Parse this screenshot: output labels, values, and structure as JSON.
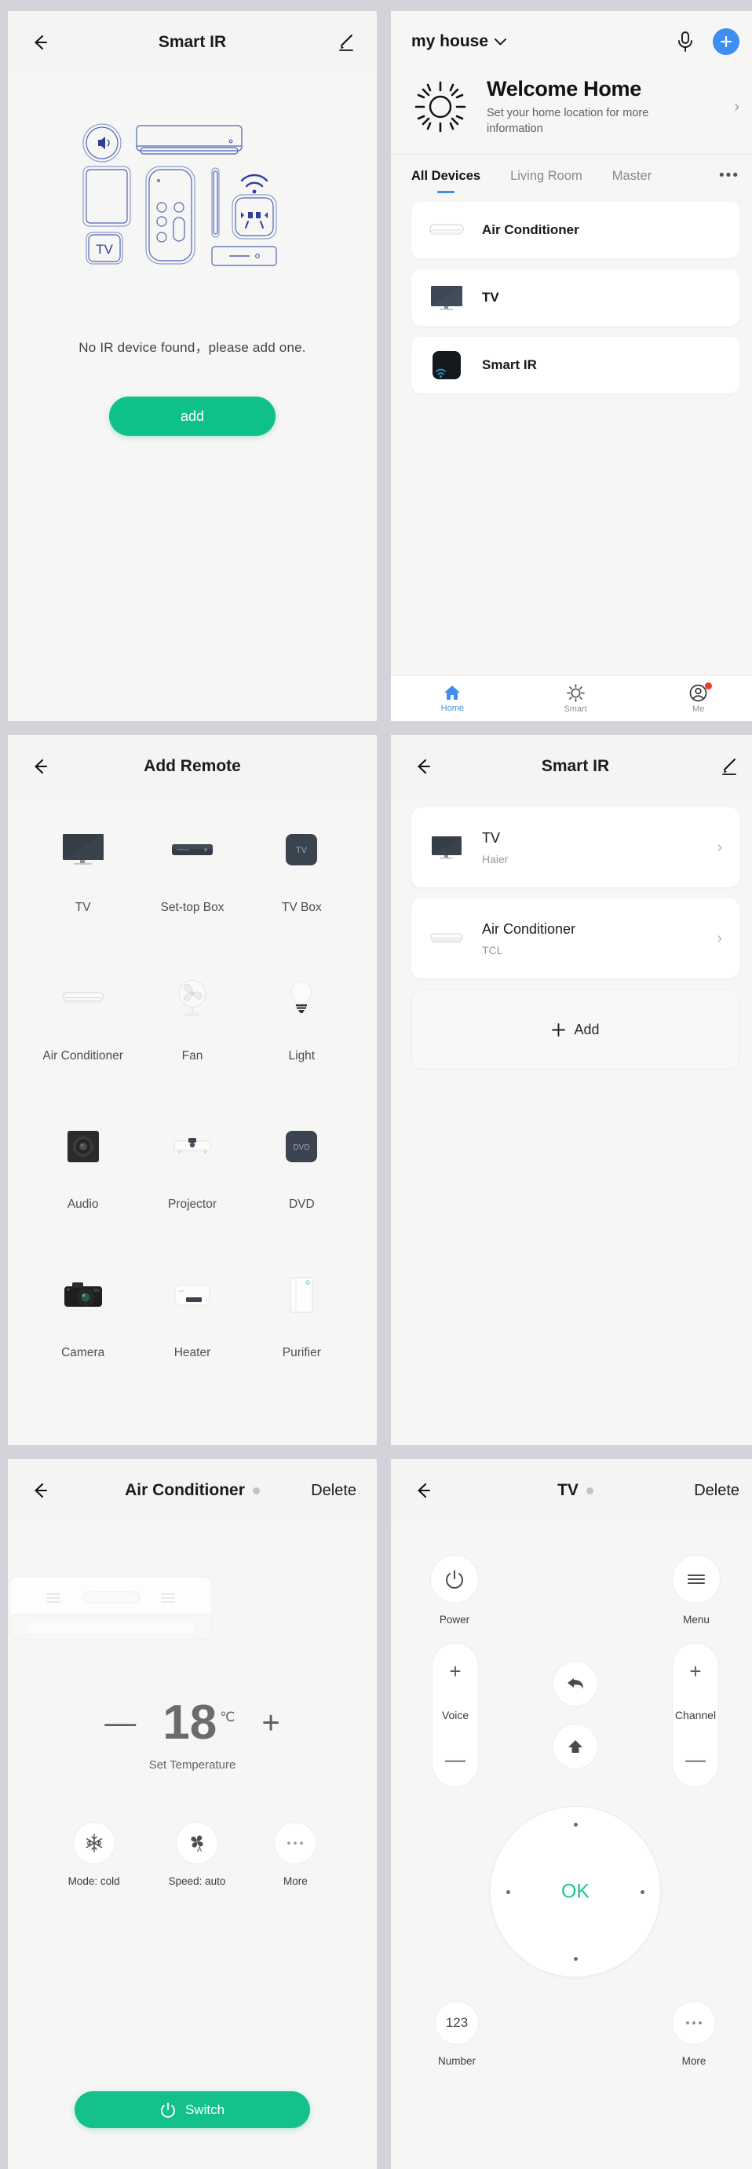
{
  "panel1": {
    "title": "Smart IR",
    "back_icon": "back-arrow-icon",
    "edit_icon": "pencil-icon",
    "illustration_label": "ir-devices-illustration",
    "tv_glyph": "TV",
    "empty_message": "No IR device found，please add one.",
    "add_button": "add"
  },
  "panel2": {
    "home_name": "my house",
    "chevron": "⌄",
    "mic_icon": "microphone-icon",
    "add_icon": "plus-icon",
    "welcome_title": "Welcome Home",
    "welcome_subtitle": "Set your home location for more information",
    "welcome_chevron": "›",
    "sun_icon": "sun-icon",
    "tabs": [
      {
        "label": "All Devices",
        "active": true
      },
      {
        "label": "Living Room",
        "active": false
      },
      {
        "label": "Master",
        "active": false
      }
    ],
    "tabs_more": "•••",
    "devices": [
      {
        "label": "Air Conditioner",
        "icon": "air-conditioner-icon"
      },
      {
        "label": "TV",
        "icon": "tv-icon"
      },
      {
        "label": "Smart IR",
        "icon": "smart-ir-hub-icon"
      }
    ],
    "tabbar": [
      {
        "label": "Home",
        "icon": "home-icon",
        "active": true,
        "badge": false
      },
      {
        "label": "Smart",
        "icon": "sun-icon",
        "active": false,
        "badge": false
      },
      {
        "label": "Me",
        "icon": "account-icon",
        "active": false,
        "badge": true
      }
    ],
    "accent_blue": "#3c8ef0",
    "badge_color": "#f2392c"
  },
  "panel3": {
    "title": "Add Remote",
    "back_icon": "back-arrow-icon",
    "items": [
      {
        "label": "TV",
        "icon": "tv-icon"
      },
      {
        "label": "Set-top Box",
        "icon": "set-top-box-icon"
      },
      {
        "label": "TV Box",
        "icon": "tv-box-icon"
      },
      {
        "label": "Air Conditioner",
        "icon": "air-conditioner-icon"
      },
      {
        "label": "Fan",
        "icon": "fan-icon"
      },
      {
        "label": "Light",
        "icon": "light-bulb-icon"
      },
      {
        "label": "Audio",
        "icon": "audio-speaker-icon"
      },
      {
        "label": "Projector",
        "icon": "projector-icon"
      },
      {
        "label": "DVD",
        "icon": "dvd-player-icon"
      },
      {
        "label": "Camera",
        "icon": "camera-icon"
      },
      {
        "label": "Heater",
        "icon": "heater-icon"
      },
      {
        "label": "Purifier",
        "icon": "air-purifier-icon"
      }
    ],
    "tvbox_glyph": "TV",
    "dvd_glyph": "DVD"
  },
  "panel4": {
    "title": "Smart IR",
    "back_icon": "back-arrow-icon",
    "edit_icon": "pencil-icon",
    "remotes": [
      {
        "name": "TV",
        "brand": "Haier",
        "icon": "tv-icon",
        "chevron": "›"
      },
      {
        "name": "Air Conditioner",
        "brand": "TCL",
        "icon": "air-conditioner-icon",
        "chevron": "›"
      }
    ],
    "add_label": "Add",
    "add_plus": "+"
  },
  "panel5": {
    "title": "Air Conditioner",
    "back_icon": "back-arrow-icon",
    "delete_label": "Delete",
    "status_dot": "offline-status-dot",
    "device_art": "air-conditioner-illustration",
    "minus": "—",
    "plus": "+",
    "temperature": "18",
    "unit": "℃",
    "temperature_caption": "Set Temperature",
    "modes": [
      {
        "label": "Mode: cold",
        "icon": "snowflake-icon"
      },
      {
        "label": "Speed: auto",
        "icon": "fan-speed-auto-icon"
      },
      {
        "label": "More",
        "icon": "more-dots-icon"
      }
    ],
    "switch_label": "Switch",
    "switch_icon": "power-icon",
    "accent_green": "#14c18c"
  },
  "panel6": {
    "title": "TV",
    "back_icon": "back-arrow-icon",
    "delete_label": "Delete",
    "status_dot": "offline-status-dot",
    "power": {
      "label": "Power",
      "icon": "power-icon"
    },
    "menu": {
      "label": "Menu",
      "icon": "hamburger-menu-icon"
    },
    "voice": {
      "label": "Voice",
      "plus": "+",
      "minus": "—"
    },
    "channel": {
      "label": "Channel",
      "plus": "+",
      "minus": "—"
    },
    "back_btn_icon": "return-arrow-icon",
    "home_btn_icon": "home-arrow-icon",
    "dpad_ok": "OK",
    "number": {
      "label": "Number",
      "glyph": "123"
    },
    "more": {
      "label": "More",
      "glyph": "•••"
    },
    "accent_green": "#16c98f"
  }
}
